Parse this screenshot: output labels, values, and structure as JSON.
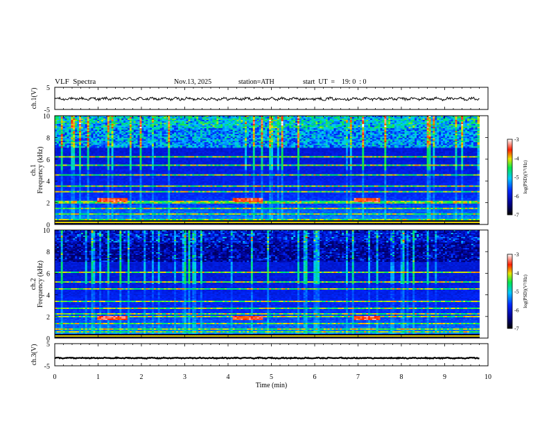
{
  "header": {
    "title": "VLF  Spectra",
    "date": "Nov.13, 2025",
    "station": "station=ATH",
    "start_label": "start  UT  =",
    "start_value": "19: 0  : 0"
  },
  "chart_data": [
    {
      "type": "line",
      "name": "ch1-waveform",
      "ylabel": "ch.1(V)",
      "ylim": [
        -5,
        5
      ],
      "yticks": [
        "5",
        "-5"
      ],
      "baseline": -0.2,
      "amplitude": 0.7
    },
    {
      "type": "heatmap",
      "name": "ch1-spectrogram",
      "ylabel": "ch.1\nFrequency  (kHz)",
      "ylim": [
        0,
        10
      ],
      "yticks": [
        "0",
        "2",
        "4",
        "6",
        "8",
        "10"
      ],
      "tone_bands_khz": [
        0.2,
        0.5,
        1.0,
        1.5,
        2.0,
        2.15,
        3.0,
        3.5,
        4.6,
        5.4,
        6.2
      ],
      "burst_segments_min": [
        [
          1.0,
          1.7
        ],
        [
          4.1,
          4.8
        ],
        [
          6.9,
          7.5
        ]
      ],
      "burst_freq_khz": 2.25
    },
    {
      "type": "heatmap",
      "name": "ch2-spectrogram",
      "ylabel": "ch.2\nFrequency  (kHz)",
      "ylim": [
        0,
        10
      ],
      "yticks": [
        "0",
        "2",
        "4",
        "6",
        "8",
        "10"
      ],
      "tone_bands_khz": [
        0.6,
        0.8,
        1.3,
        2.0,
        2.2,
        2.8,
        3.4,
        4.6,
        5.2,
        6.1
      ],
      "burst_segments_min": [
        [
          1.0,
          1.7
        ],
        [
          4.1,
          4.8
        ],
        [
          6.9,
          7.5
        ]
      ],
      "burst_freq_khz": 1.85
    },
    {
      "type": "line",
      "name": "ch3-waveform",
      "ylabel": "ch.3(V)",
      "ylim": [
        -5,
        5
      ],
      "yticks": [
        "5",
        "-5"
      ],
      "baseline": -1.5,
      "amplitude": 0.25
    }
  ],
  "xaxis": {
    "label": "Time  (min)",
    "xlim": [
      0,
      10
    ],
    "ticks": [
      "0",
      "1",
      "2",
      "3",
      "4",
      "5",
      "6",
      "7",
      "8",
      "9",
      "10"
    ],
    "data_end_min": 9.8
  },
  "colorbar": {
    "label": "log(PSD)(V²/Hz)",
    "range": [
      -7,
      -3
    ],
    "ticks": [
      "-3",
      "-4",
      "-5",
      "-6",
      "-7"
    ]
  }
}
